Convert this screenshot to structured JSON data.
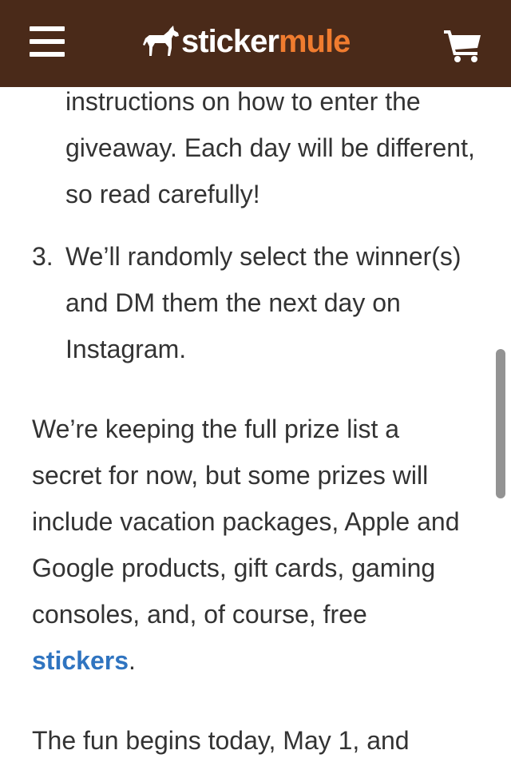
{
  "header": {
    "background": "#4a2a19",
    "menu_icon": "hamburger-menu-icon",
    "logo": {
      "part1": "sticker",
      "part2": "mule",
      "part1_color": "#ffffff",
      "part2_color": "#f07c2f",
      "mark_icon": "mule-icon"
    },
    "cart_icon": "shopping-cart-icon"
  },
  "content": {
    "list_continuation": "instructions on how to enter the giveaway. Each day will be different, so read carefully!",
    "list_item_3": {
      "number": "3.",
      "text": "We’ll randomly select the winner(s) and DM them the next day on Instagram."
    },
    "prize_paragraph": {
      "text_before_link": "We’re keeping the full prize list a secret for now, but some prizes will include vacation packages, Apple and Google products, gift cards, gaming consoles, and, of course, free ",
      "link_text": "stickers",
      "text_after_link": ".",
      "link_color": "#2f74c0"
    },
    "closing_paragraph_partial": "The fun begins today, May 1, and"
  }
}
